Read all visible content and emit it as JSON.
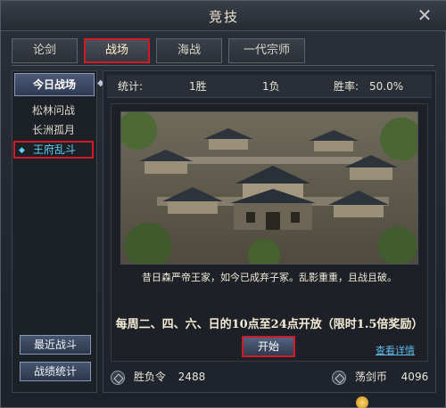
{
  "window": {
    "title": "竞技",
    "close_glyph": "✕"
  },
  "tabs": [
    {
      "label": "论剑",
      "active": false
    },
    {
      "label": "战场",
      "active": true
    },
    {
      "label": "海战",
      "active": false
    },
    {
      "label": "一代宗师",
      "active": false
    }
  ],
  "sidebar": {
    "header": "今日战场",
    "items": [
      {
        "label": "松林问战",
        "active": false
      },
      {
        "label": "长洲孤月",
        "active": false
      },
      {
        "label": "王府乱斗",
        "active": true
      }
    ],
    "buttons": {
      "recent": "最近战斗",
      "stats": "战绩统计"
    }
  },
  "stats": {
    "label": "统计:",
    "wins": "1胜",
    "losses": "1负",
    "win_rate_label": "胜率:",
    "win_rate": "50.0%"
  },
  "battlefield": {
    "description": "昔日森严帝王家，如今已成弃子冢。乱影重重，且战且破。",
    "schedule": "每周二、四、六、日的10点至24点开放（限时1.5倍奖励）",
    "start_label": "开始",
    "details_label": "查看详情"
  },
  "currency": {
    "left": {
      "name": "胜负令",
      "value": "2488",
      "icon": "token-icon"
    },
    "right": {
      "name": "荡剑币",
      "value": "4096",
      "icon": "coin-icon"
    }
  },
  "colors": {
    "highlight": "#d01a28",
    "accent": "#5fd2f0",
    "link": "#5fb8e8"
  }
}
